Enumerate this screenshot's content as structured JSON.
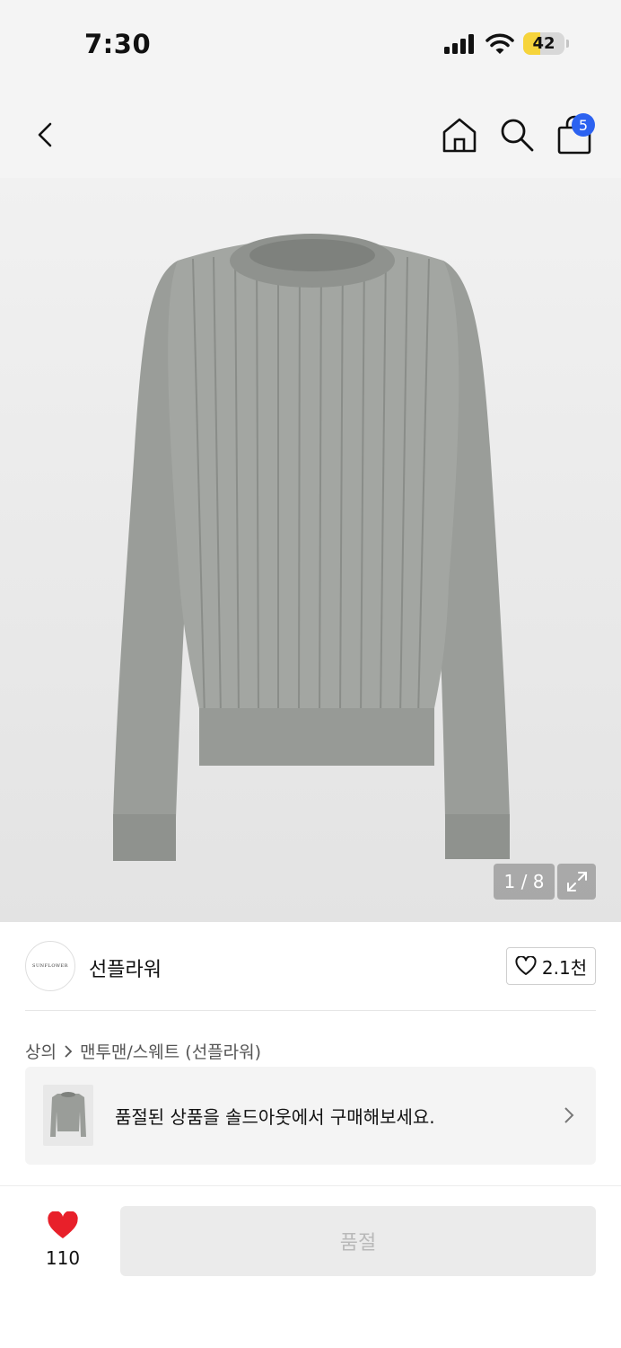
{
  "status_bar": {
    "time": "7:30",
    "battery_level": "42",
    "battery_fraction": 0.42,
    "icons": [
      "signal-icon",
      "wifi-icon",
      "battery-icon"
    ]
  },
  "nav": {
    "icons": [
      "back-icon",
      "home-icon",
      "search-icon",
      "shopping-bag-icon"
    ],
    "cart_count": "5"
  },
  "product_image": {
    "page_indicator": "1 / 8"
  },
  "brand": {
    "logo_text": "SUNFLOWER",
    "name": "선플라워",
    "like_count": "2.1천"
  },
  "breadcrumb": {
    "category": "상의",
    "subcategory": "맨투맨/스웨트 (선플라워)"
  },
  "soldout_banner": {
    "text": "품절된 상품을 솔드아웃에서 구매해보세요."
  },
  "bottom_bar": {
    "wish_count": "110",
    "button_label": "품절"
  },
  "colors": {
    "accent_badge": "#2c62f0",
    "heart": "#e8202a",
    "battery": "#f6d43b",
    "disabled_button": "#ebebeb"
  }
}
